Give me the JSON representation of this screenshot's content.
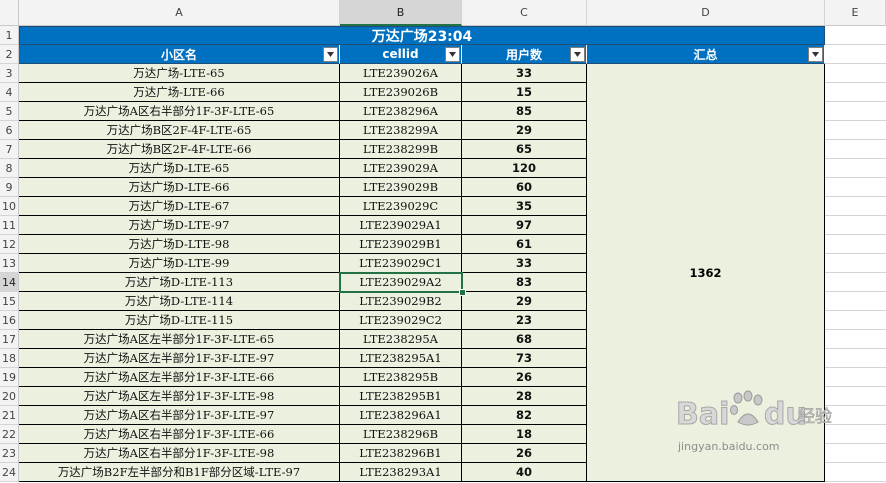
{
  "columns": [
    "A",
    "B",
    "C",
    "D",
    "E"
  ],
  "rows": [
    "1",
    "2",
    "3",
    "4",
    "5",
    "6",
    "7",
    "8",
    "9",
    "10",
    "11",
    "12",
    "13",
    "14",
    "15",
    "16",
    "17",
    "18",
    "19",
    "20",
    "21",
    "22",
    "23",
    "24"
  ],
  "title": "万达广场23:04",
  "headers": {
    "name": "小区名",
    "cellid": "cellid",
    "users": "用户数",
    "total": "汇总"
  },
  "data": [
    {
      "name": "万达广场-LTE-65",
      "cellid": "LTE239026A",
      "users": "33"
    },
    {
      "name": "万达广场-LTE-66",
      "cellid": "LTE239026B",
      "users": "15"
    },
    {
      "name": "万达广场A区右半部分1F-3F-LTE-65",
      "cellid": "LTE238296A",
      "users": "85"
    },
    {
      "name": "万达广场B区2F-4F-LTE-65",
      "cellid": "LTE238299A",
      "users": "29"
    },
    {
      "name": "万达广场B区2F-4F-LTE-66",
      "cellid": "LTE238299B",
      "users": "65"
    },
    {
      "name": "万达广场D-LTE-65",
      "cellid": "LTE239029A",
      "users": "120"
    },
    {
      "name": "万达广场D-LTE-66",
      "cellid": "LTE239029B",
      "users": "60"
    },
    {
      "name": "万达广场D-LTE-67",
      "cellid": "LTE239029C",
      "users": "35"
    },
    {
      "name": "万达广场D-LTE-97",
      "cellid": "LTE239029A1",
      "users": "97"
    },
    {
      "name": "万达广场D-LTE-98",
      "cellid": "LTE239029B1",
      "users": "61"
    },
    {
      "name": "万达广场D-LTE-99",
      "cellid": "LTE239029C1",
      "users": "33"
    },
    {
      "name": "万达广场D-LTE-113",
      "cellid": "LTE239029A2",
      "users": "83"
    },
    {
      "name": "万达广场D-LTE-114",
      "cellid": "LTE239029B2",
      "users": "29"
    },
    {
      "name": "万达广场D-LTE-115",
      "cellid": "LTE239029C2",
      "users": "23"
    },
    {
      "name": "万达广场A区左半部分1F-3F-LTE-65",
      "cellid": "LTE238295A",
      "users": "68"
    },
    {
      "name": "万达广场A区左半部分1F-3F-LTE-97",
      "cellid": "LTE238295A1",
      "users": "73"
    },
    {
      "name": "万达广场A区左半部分1F-3F-LTE-66",
      "cellid": "LTE238295B",
      "users": "26"
    },
    {
      "name": "万达广场A区左半部分1F-3F-LTE-98",
      "cellid": "LTE238295B1",
      "users": "28"
    },
    {
      "name": "万达广场A区右半部分1F-3F-LTE-97",
      "cellid": "LTE238296A1",
      "users": "82"
    },
    {
      "name": "万达广场A区右半部分1F-3F-LTE-66",
      "cellid": "LTE238296B",
      "users": "18"
    },
    {
      "name": "万达广场A区右半部分1F-3F-LTE-98",
      "cellid": "LTE238296B1",
      "users": "26"
    },
    {
      "name": "万达广场B2F左半部分和B1F部分区域-LTE-97",
      "cellid": "LTE238293A1",
      "users": "40"
    }
  ],
  "total_value": "1362",
  "watermark": {
    "brand_left": "Bai",
    "brand_right": "du",
    "product": "经验",
    "url": "jingyan.baidu.com"
  },
  "colors": {
    "header_blue": "#0070c0",
    "data_fill": "#ebf1de",
    "selection": "#217346"
  },
  "selected_cell": "B14"
}
